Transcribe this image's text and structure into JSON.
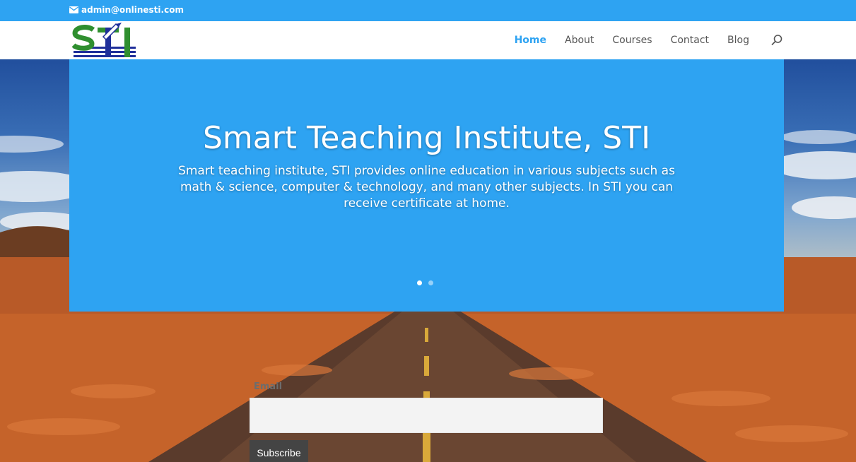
{
  "topbar": {
    "email": "admin@onlinesti.com",
    "icon": "mail-icon"
  },
  "header": {
    "logo_text": "STI",
    "nav": [
      {
        "label": "Home",
        "active": true
      },
      {
        "label": "About",
        "active": false
      },
      {
        "label": "Courses",
        "active": false
      },
      {
        "label": "Contact",
        "active": false
      },
      {
        "label": "Blog",
        "active": false
      }
    ],
    "search_icon": "search-icon"
  },
  "slider": {
    "title": "Smart Teaching Institute, STI",
    "text": "Smart teaching institute, STI provides online education in various subjects such as math & science, computer & technology, and many other subjects. In STI you can receive certificate at home.",
    "dot_count": 2,
    "active_dot": 1
  },
  "form": {
    "email_label": "Email",
    "email_value": "",
    "button_label": "Subscribe"
  },
  "colors": {
    "accent": "#2ea3f2",
    "button": "#444444"
  }
}
